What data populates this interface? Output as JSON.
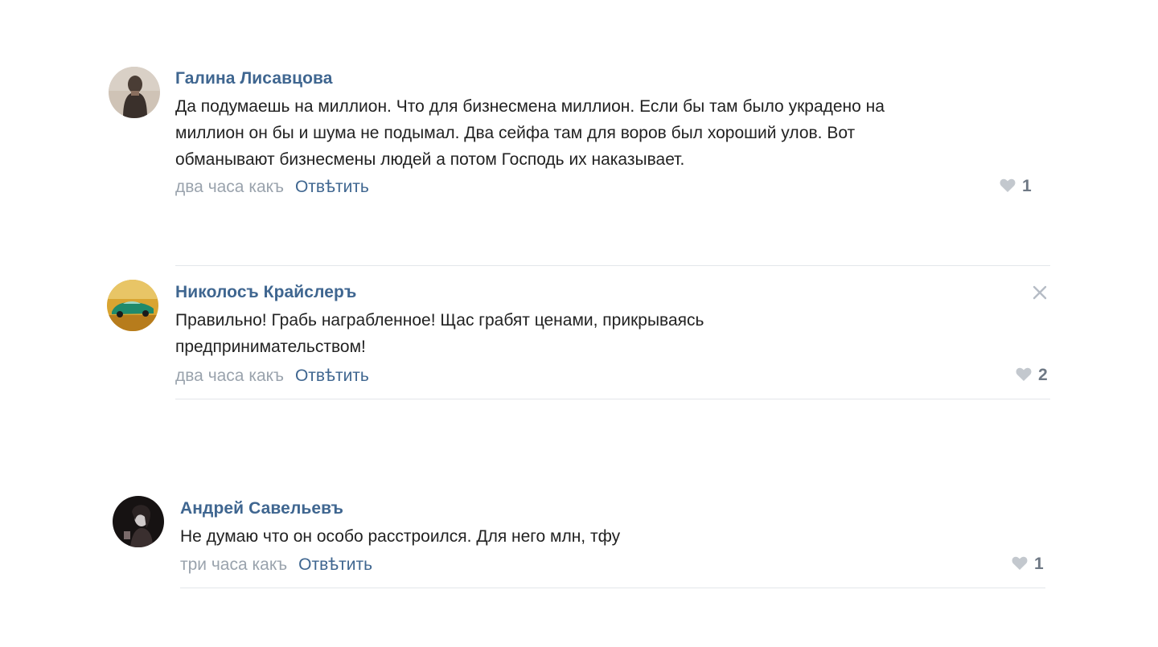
{
  "comments": [
    {
      "author": "Галина Лисавцова",
      "text": "Да подумаешь на миллион. Что для бизнесмена миллион. Если бы там было украдено на\nмиллион он бы и шума не подымал. Два сейфа там для воров был хороший улов. Вот\nобманывают бизнесмены людей а потом Господь их наказывает.",
      "time": "два часа какъ",
      "reply": "Отвѣтить",
      "likes": "1",
      "avatar_icon": "avatar-woman-photo"
    },
    {
      "author": "Николосъ Крайслеръ",
      "text": "Правильно! Грабь награбленное! Щас грабят ценами, прикрываясь\nпредпринимательством!",
      "time": "два часа какъ",
      "reply": "Отвѣтить",
      "likes": "2",
      "avatar_icon": "avatar-green-car-photo",
      "close_icon": "close-icon"
    },
    {
      "author": "Андрей Савельевъ",
      "text": "Не думаю что он особо расстроился. Для него млн, тфу",
      "time": "три часа какъ",
      "reply": "Отвѣтить",
      "likes": "1",
      "avatar_icon": "avatar-dark-portrait-photo"
    }
  ],
  "colors": {
    "author": "#3f6690",
    "reply": "#3f6690",
    "time": "#9aa3ad",
    "likes": "#6f7985",
    "heart": "#c3c8ce",
    "divider": "#e3e6ea"
  }
}
